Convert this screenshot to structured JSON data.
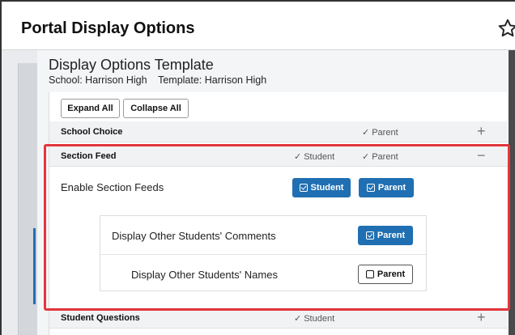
{
  "header": {
    "title": "Portal Display Options"
  },
  "template": {
    "title": "Display Options Template",
    "school": "School: Harrison High",
    "template_name": "Template: Harrison High"
  },
  "toolbar": {
    "expand_all": "Expand All",
    "collapse_all": "Collapse All"
  },
  "rows": {
    "school_choice": {
      "label": "School Choice",
      "parent": "Parent",
      "toggle": "+"
    },
    "section_feed": {
      "label": "Section Feed",
      "student": "Student",
      "parent": "Parent",
      "toggle": "−"
    },
    "student_questions": {
      "label": "Student Questions",
      "student": "Student",
      "toggle": "+"
    }
  },
  "check_mark": "✓",
  "enable": {
    "label": "Enable Section Feeds",
    "student_btn": "Student",
    "parent_btn": "Parent"
  },
  "sub": {
    "comments_label": "Display Other Students' Comments",
    "comments_btn": "Parent",
    "names_label": "Display Other Students' Names",
    "names_btn": "Parent"
  },
  "colors": {
    "accent": "#1f6fb2",
    "highlight": "#e2363c"
  }
}
